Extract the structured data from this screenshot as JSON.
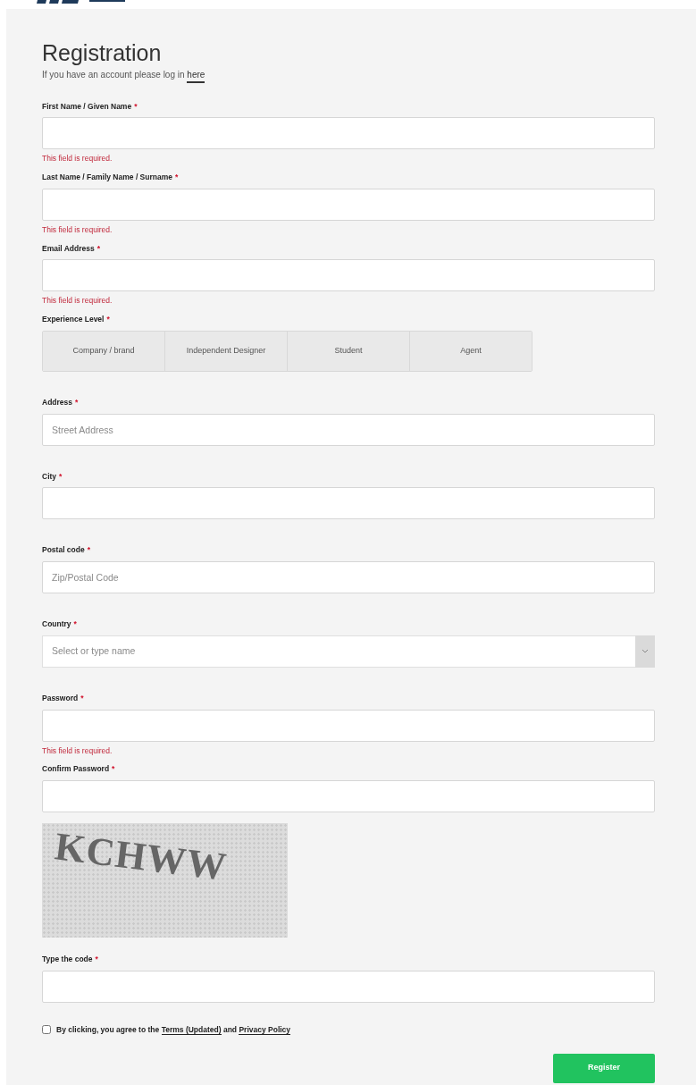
{
  "title": "Registration",
  "subtitle": {
    "text": "If you have an account please log in",
    "link": "here"
  },
  "fields": [
    {
      "kind": "text",
      "label": "First Name / Given Name",
      "required_mark": "*",
      "error": "This field is required."
    },
    {
      "kind": "text",
      "label": "Last Name / Family Name / Surname",
      "required_mark": "*",
      "error": "This field is required."
    },
    {
      "kind": "text",
      "label": "Email Address",
      "required_mark": "*",
      "error": "This field is required."
    },
    {
      "kind": "segmented",
      "label": "Experience Level",
      "required_mark": "*",
      "options": [
        {
          "label": "Company / brand",
          "selected": false
        },
        {
          "label": "Independent Designer",
          "selected": false
        },
        {
          "label": "Student",
          "selected": false
        },
        {
          "label": "Agent",
          "selected": false
        }
      ]
    },
    {
      "kind": "text",
      "label": "Address",
      "required_mark": "*",
      "placeholder": "Street Address"
    },
    {
      "kind": "text",
      "label": "City",
      "required_mark": "*"
    },
    {
      "kind": "text",
      "label": "Postal code",
      "required_mark": "*",
      "placeholder": "Zip/Postal Code"
    },
    {
      "kind": "select",
      "label": "Country",
      "required_mark": "*",
      "placeholder": "Select or type name"
    },
    {
      "kind": "password",
      "label": "Password",
      "required_mark": "*",
      "error": "This field is required."
    },
    {
      "kind": "password",
      "label": "Confirm Password",
      "required_mark": "*"
    },
    {
      "kind": "captcha",
      "captcha_text": "KCHWW"
    },
    {
      "kind": "text",
      "label": "Type the code",
      "required_mark": "*"
    }
  ],
  "agreement": {
    "checked": false,
    "parts": [
      {
        "kind": "text",
        "text": "By clicking, you agree to the"
      },
      {
        "kind": "link",
        "text": "Terms (Updated)"
      },
      {
        "kind": "text",
        "text": "and"
      },
      {
        "kind": "link",
        "text": "Privacy Policy"
      }
    ]
  },
  "submit": "Register"
}
